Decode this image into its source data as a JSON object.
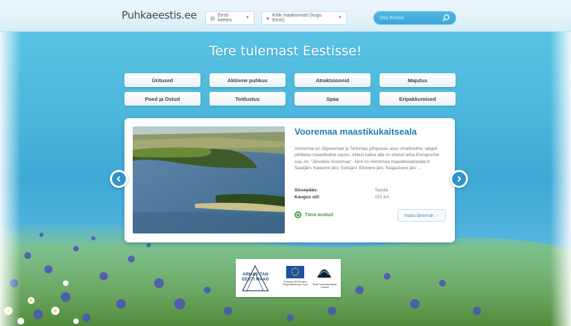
{
  "header": {
    "logo": "Puhkaeestis.ee",
    "language_select": "Eesti keeles",
    "region_select": "Kõik maakonnad (kogu Eesti)",
    "search_placeholder": "Otsi Eestist"
  },
  "welcome": "Tere tulemast Eestisse!",
  "categories": [
    "Üritused",
    "Aktiivne puhkus",
    "Atraktsioonid",
    "Majutus",
    "Poed ja Ostud",
    "Toitlustus",
    "Spaa",
    "Eripakkumised"
  ],
  "featured": {
    "title": "Vooremaa maastikukaitseala",
    "description": "Vooremaa on Jõgevamaal ja Tartumaa põhjaosas asuv omailmeline, selgelt piiritletav maastikuline rajoon, millest kaitse alla on võetud tema lõunapoolne osa, nn. \"Järveline Vooremaa\". Järvi on Vooremaa maastikukaitsealal 8: Saadjärv, Kaiavere järv, Soitsjärv, Elistvere järv, Raigastvere järv ...",
    "entry_label": "Sissepääs:",
    "entry_value": "Tasuta",
    "distance_label": "Kaugus siit:",
    "distance_value": "151 km",
    "status": "Täna avatud",
    "more_button": "Vaata lähemalt →"
  },
  "sponsors": {
    "logo1_text": "ARMAS TAN EESTI MAAD",
    "eu_caption": "Euroopa Liit Euroopa Regionaalarengu Fond",
    "ee_caption": "Eesti Turismiarenduse Keskus"
  },
  "colors": {
    "accent": "#1f7fb0",
    "button_blue": "#2f93c8",
    "open_green": "#4aa040"
  }
}
